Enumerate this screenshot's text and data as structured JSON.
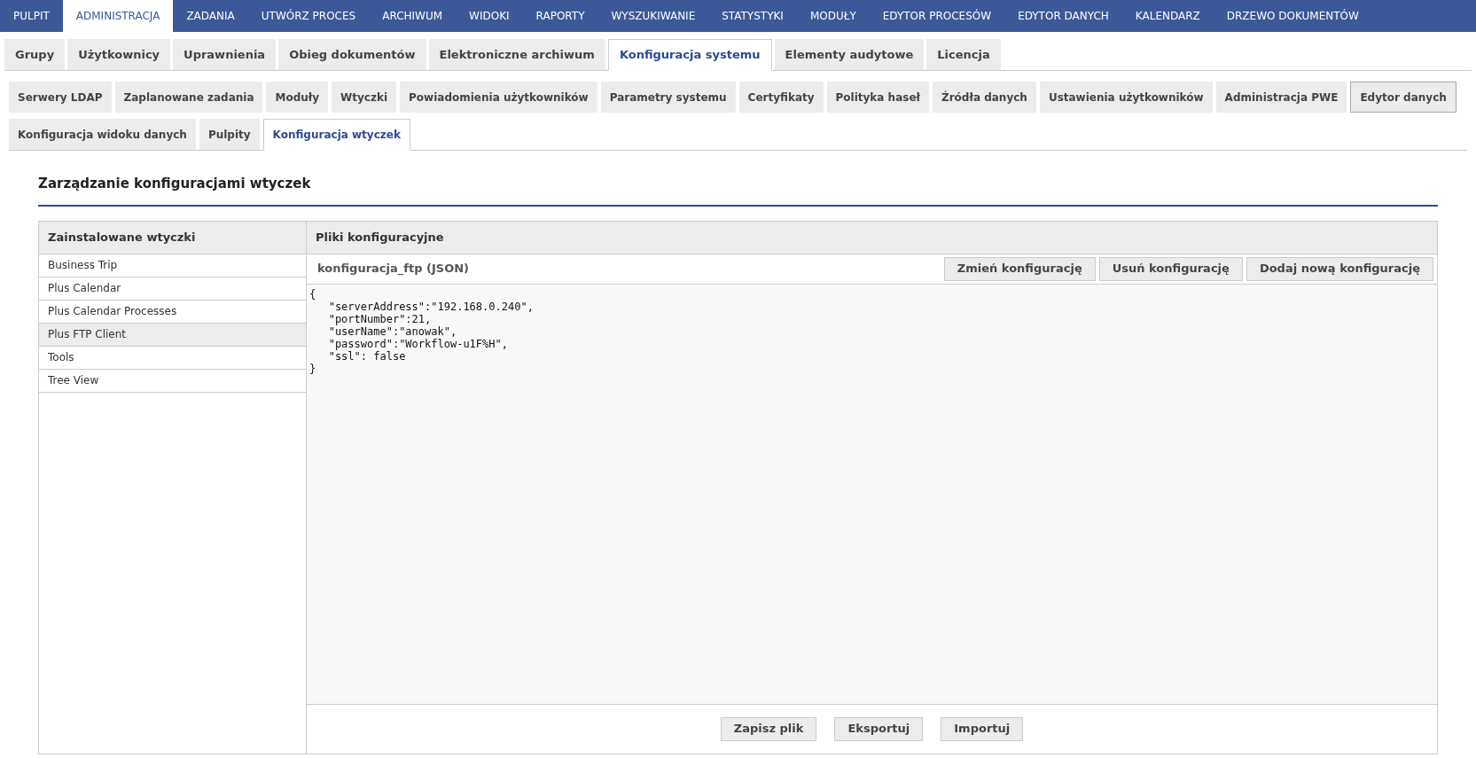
{
  "top_nav": [
    {
      "label": "PULPIT",
      "selected": false
    },
    {
      "label": "ADMINISTRACJA",
      "selected": true
    },
    {
      "label": "ZADANIA",
      "selected": false
    },
    {
      "label": "UTWÓRZ PROCES",
      "selected": false
    },
    {
      "label": "ARCHIWUM",
      "selected": false
    },
    {
      "label": "WIDOKI",
      "selected": false
    },
    {
      "label": "RAPORTY",
      "selected": false
    },
    {
      "label": "WYSZUKIWANIE",
      "selected": false
    },
    {
      "label": "STATYSTYKI",
      "selected": false
    },
    {
      "label": "MODUŁY",
      "selected": false
    },
    {
      "label": "EDYTOR PROCESÓW",
      "selected": false
    },
    {
      "label": "EDYTOR DANYCH",
      "selected": false
    },
    {
      "label": "KALENDARZ",
      "selected": false
    },
    {
      "label": "DRZEWO DOKUMENTÓW",
      "selected": false
    }
  ],
  "tabs": [
    {
      "label": "Grupy",
      "selected": false
    },
    {
      "label": "Użytkownicy",
      "selected": false
    },
    {
      "label": "Uprawnienia",
      "selected": false
    },
    {
      "label": "Obieg dokumentów",
      "selected": false
    },
    {
      "label": "Elektroniczne archiwum",
      "selected": false
    },
    {
      "label": "Konfiguracja systemu",
      "selected": true
    },
    {
      "label": "Elementy audytowe",
      "selected": false
    },
    {
      "label": "Licencja",
      "selected": false
    }
  ],
  "subtabs": [
    {
      "label": "Serwery LDAP",
      "selected": false,
      "outlined": false
    },
    {
      "label": "Zaplanowane zadania",
      "selected": false,
      "outlined": false
    },
    {
      "label": "Moduły",
      "selected": false,
      "outlined": false
    },
    {
      "label": "Wtyczki",
      "selected": false,
      "outlined": false
    },
    {
      "label": "Powiadomienia użytkowników",
      "selected": false,
      "outlined": false
    },
    {
      "label": "Parametry systemu",
      "selected": false,
      "outlined": false
    },
    {
      "label": "Certyfikaty",
      "selected": false,
      "outlined": false
    },
    {
      "label": "Polityka haseł",
      "selected": false,
      "outlined": false
    },
    {
      "label": "Źródła danych",
      "selected": false,
      "outlined": false
    },
    {
      "label": "Ustawienia użytkowników",
      "selected": false,
      "outlined": false
    },
    {
      "label": "Administracja PWE",
      "selected": false,
      "outlined": false
    },
    {
      "label": "Edytor danych",
      "selected": false,
      "outlined": true
    },
    {
      "label": "Konfiguracja widoku danych",
      "selected": false,
      "outlined": false
    },
    {
      "label": "Pulpity",
      "selected": false,
      "outlined": false
    },
    {
      "label": "Konfiguracja wtyczek",
      "selected": true,
      "outlined": false
    }
  ],
  "page_title": "Zarządzanie konfiguracjami wtyczek",
  "plugins": {
    "header": "Zainstalowane wtyczki",
    "items": [
      {
        "label": "Business Trip",
        "selected": false
      },
      {
        "label": "Plus Calendar",
        "selected": false
      },
      {
        "label": "Plus Calendar Processes",
        "selected": false
      },
      {
        "label": "Plus FTP Client",
        "selected": true
      },
      {
        "label": "Tools",
        "selected": false
      },
      {
        "label": "Tree View",
        "selected": false
      }
    ]
  },
  "config_files": {
    "header": "Pliki konfiguracyjne",
    "file_name": "konfiguracja_ftp (JSON)",
    "actions": [
      "Zmień konfigurację",
      "Usuń konfigurację",
      "Dodaj nową konfigurację"
    ],
    "editor_lines": [
      "{",
      "   \"serverAddress\":\"192.168.0.240\",",
      "   \"portNumber\":21,",
      "   \"userName\":\"anowak\",",
      "   \"password\":\"Workflow-u1F%H\",",
      "   \"ssl\": false",
      "}"
    ],
    "footer_buttons": [
      "Zapisz plik",
      "Eksportuj",
      "Importuj"
    ]
  }
}
